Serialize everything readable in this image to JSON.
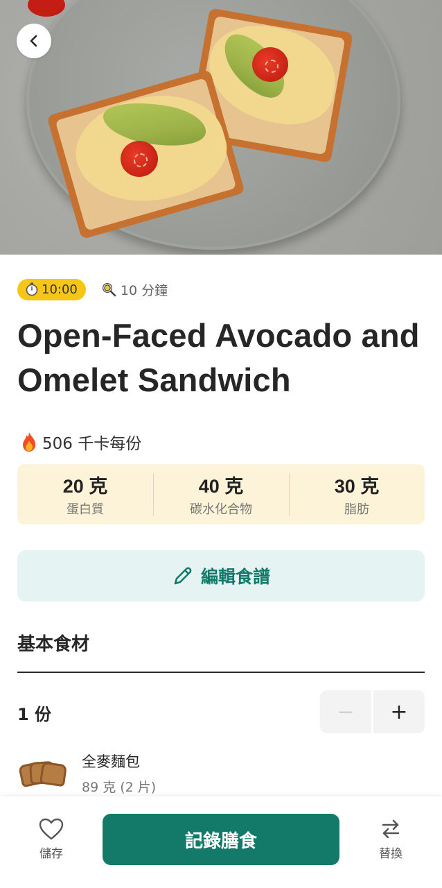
{
  "header": {
    "back_icon": "chevron-left-icon"
  },
  "meta": {
    "prep_time": "10:00",
    "prep_icon": "stopwatch-icon",
    "cook_time": "10 分鐘",
    "cook_icon": "frying-pan-icon"
  },
  "recipe": {
    "title": "Open-Faced Avocado and Omelet Sandwich",
    "calories": "506 千卡每份",
    "calories_icon": "fire-icon"
  },
  "macros": [
    {
      "value": "20 克",
      "label": "蛋白質"
    },
    {
      "value": "40 克",
      "label": "碳水化合物"
    },
    {
      "value": "30 克",
      "label": "脂肪"
    }
  ],
  "colors": {
    "accent": "#137a69",
    "timer_pill": "#f5c518",
    "macro_bg": "#fdf3d8",
    "edit_bg": "#e5f3f2"
  },
  "actions": {
    "edit_label": "編輯食譜",
    "edit_icon": "pencil-icon"
  },
  "ingredients_section": {
    "title": "基本食材",
    "servings": "1 份",
    "minus": "−",
    "plus": "+",
    "items": [
      {
        "name": "全麥麵包",
        "amount": "89 克 (2 片)",
        "icon": "bread-slices-icon"
      }
    ]
  },
  "bottom_bar": {
    "save_label": "儲存",
    "save_icon": "heart-icon",
    "log_label": "記錄膳食",
    "swap_label": "替換",
    "swap_icon": "swap-arrows-icon"
  }
}
